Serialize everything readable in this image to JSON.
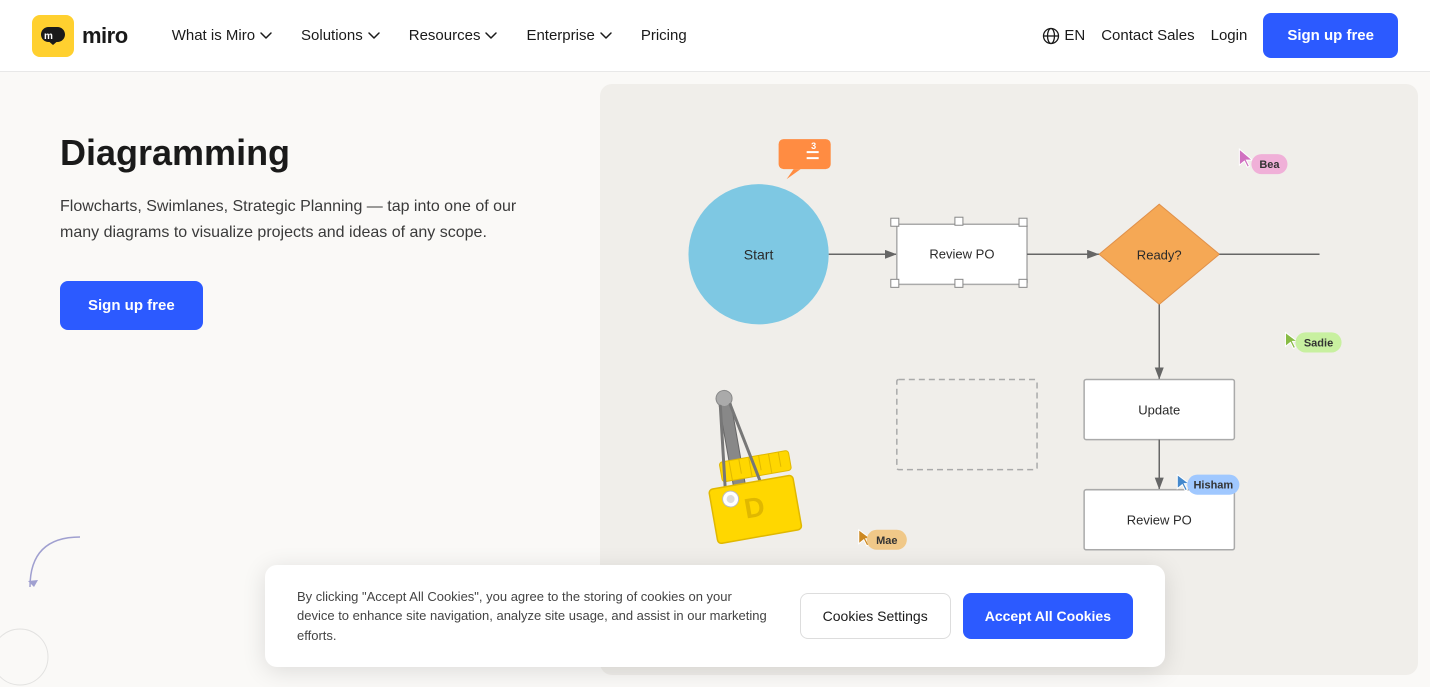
{
  "nav": {
    "logo_text": "miro",
    "links": [
      {
        "label": "What is Miro",
        "has_dropdown": true
      },
      {
        "label": "Solutions",
        "has_dropdown": true
      },
      {
        "label": "Resources",
        "has_dropdown": true
      },
      {
        "label": "Enterprise",
        "has_dropdown": true
      },
      {
        "label": "Pricing",
        "has_dropdown": false
      }
    ],
    "lang": "EN",
    "contact_sales": "Contact Sales",
    "login": "Login",
    "signup": "Sign up free"
  },
  "hero": {
    "title": "Diagramming",
    "description": "Flowcharts, Swimlanes, Strategic Planning — tap into one of our many diagrams to visualize projects and ideas of any scope.",
    "cta": "Sign up free"
  },
  "diagram": {
    "nodes": {
      "start": "Start",
      "review_po_1": "Review PO",
      "ready": "Ready?",
      "update": "Update",
      "review_po_2": "Review PO"
    },
    "cursors": [
      {
        "name": "Bea",
        "color": "#f0b0d8"
      },
      {
        "name": "Sadie",
        "color": "#c8f0a0"
      },
      {
        "name": "Mae",
        "color": "#f0c070"
      },
      {
        "name": "Hisham",
        "color": "#a0c8ff"
      }
    ]
  },
  "cookie": {
    "text": "By clicking \"Accept All Cookies\", you agree to the storing of cookies on your device to enhance site navigation, analyze site usage, and assist in our marketing efforts.",
    "settings_label": "Cookies Settings",
    "accept_label": "Accept All Cookies"
  }
}
